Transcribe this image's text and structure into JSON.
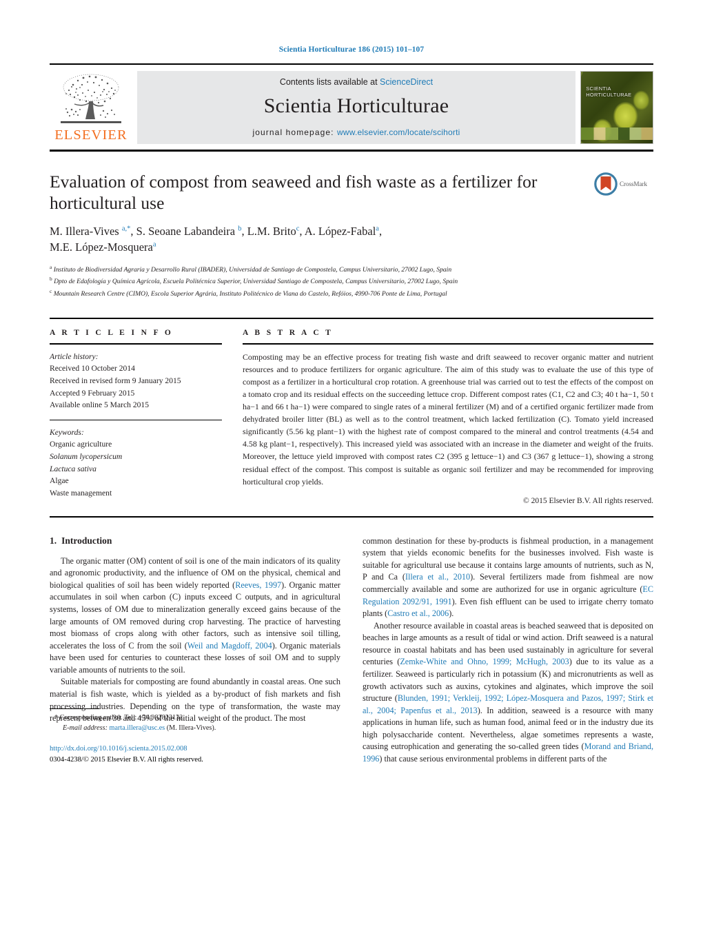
{
  "running_head": "Scientia Horticulturae 186 (2015) 101–107",
  "masthead": {
    "publisher_logo_text": "ELSEVIER",
    "contents_prefix": "Contents lists available at ",
    "contents_link": "ScienceDirect",
    "journal_name": "Scientia Horticulturae",
    "homepage_prefix": "journal homepage: ",
    "homepage_url": "www.elsevier.com/locate/scihorti",
    "cover_title": "SCIENTIA HORTICULTURAE"
  },
  "article": {
    "title": "Evaluation of compost from seaweed and fish waste as a fertilizer for horticultural use",
    "crossmark_label": "CrossMark",
    "authors_line_1": "M. Illera-Vives ",
    "authors_line_1_sup": "a,*",
    "authors_line_1_b": ", S. Seoane Labandeira ",
    "authors_line_1_sup_b": "b",
    "authors_line_1_c": ", L.M. Brito",
    "authors_line_1_sup_c": "c",
    "authors_line_1_d": ", A. López-Fabal",
    "authors_line_1_sup_d": "a",
    "authors_line_1_e": ",",
    "authors_line_2": "M.E. López-Mosquera",
    "authors_line_2_sup": "a",
    "affiliations": [
      {
        "mark": "a",
        "text": "Instituto de Biodiversidad Agraria y Desarrollo Rural (IBADER), Universidad de Santiago de Compostela, Campus Universitario, 27002 Lugo, Spain"
      },
      {
        "mark": "b",
        "text": "Dpto de Edafología y Química Agrícola, Escuela Politécnica Superior, Universidad Santiago de Compostela, Campus Universitario, 27002 Lugo, Spain"
      },
      {
        "mark": "c",
        "text": "Mountain Research Centre (CIMO), Escola Superior Agrária, Instituto Politécnico de Viana do Castelo, Refóios, 4990-706 Ponte de Lima, Portugal"
      }
    ]
  },
  "article_info": {
    "heading": "A R T I C L E    I N F O",
    "history_label": "Article history:",
    "history": [
      "Received 10 October 2014",
      "Received in revised form 9 January 2015",
      "Accepted 9 February 2015",
      "Available online 5 March 2015"
    ],
    "keywords_label": "Keywords:",
    "keywords": [
      {
        "text": "Organic agriculture",
        "italic": false
      },
      {
        "text": "Solanum lycopersicum",
        "italic": true
      },
      {
        "text": "Lactuca sativa",
        "italic": true
      },
      {
        "text": "Algae",
        "italic": false
      },
      {
        "text": "Waste management",
        "italic": false
      }
    ]
  },
  "abstract": {
    "heading": "A B S T R A C T",
    "text": "Composting may be an effective process for treating fish waste and drift seaweed to recover organic matter and nutrient resources and to produce fertilizers for organic agriculture. The aim of this study was to evaluate the use of this type of compost as a fertilizer in a horticultural crop rotation. A greenhouse trial was carried out to test the effects of the compost on a tomato crop and its residual effects on the succeeding lettuce crop. Different compost rates (C1, C2 and C3; 40 t ha−1, 50 t ha−1 and 66 t ha−1) were compared to single rates of a mineral fertilizer (M) and of a certified organic fertilizer made from dehydrated broiler litter (BL) as well as to the control treatment, which lacked fertilization (C). Tomato yield increased significantly (5.56 kg plant−1) with the highest rate of compost compared to the mineral and control treatments (4.54 and 4.58 kg plant−1, respectively). This increased yield was associated with an increase in the diameter and weight of the fruits. Moreover, the lettuce yield improved with compost rates C2 (395 g lettuce−1) and C3 (367 g lettuce−1), showing a strong residual effect of the compost. This compost is suitable as organic soil fertilizer and may be recommended for improving horticultural crop yields.",
    "copyright": "© 2015 Elsevier B.V. All rights reserved."
  },
  "body": {
    "section_number": "1.",
    "section_title": "Introduction",
    "left_paragraph_1_a": "The organic matter (OM) content of soil is one of the main indicators of its quality and agronomic productivity, and the influence of OM on the physical, chemical and biological qualities of soil has been widely reported (",
    "left_paragraph_1_ref1": "Reeves, 1997",
    "left_paragraph_1_b": "). Organic matter accumulates in soil when carbon (C) inputs exceed C outputs, and in agricultural systems, losses of OM due to mineralization generally exceed gains because of the large amounts of OM removed during crop harvesting. The practice of harvesting most biomass of crops along with other factors, such as intensive soil tilling, accelerates the loss of C from the soil (",
    "left_paragraph_1_ref2": "Weil and Magdoff, 2004",
    "left_paragraph_1_c": "). Organic materials have been used for centuries to counteract these losses of soil OM and to supply variable amounts of nutrients to the soil.",
    "left_paragraph_2": "Suitable materials for composting are found abundantly in coastal areas. One such material is fish waste, which is yielded as a by-product of fish markets and fish processing industries. Depending on the type of transformation, the waste may represent between 30 and 45% of the initial weight of the product. The most",
    "right_paragraph_1_a": "common destination for these by-products is fishmeal production, in a management system that yields economic benefits for the businesses involved. Fish waste is suitable for agricultural use because it contains large amounts of nutrients, such as N, P and Ca (",
    "right_paragraph_1_ref1": "Illera et al., 2010",
    "right_paragraph_1_b": "). Several fertilizers made from fishmeal are now commercially available and some are authorized for use in organic agriculture (",
    "right_paragraph_1_ref2": "EC Regulation 2092/91, 1991",
    "right_paragraph_1_c": "). Even fish effluent can be used to irrigate cherry tomato plants (",
    "right_paragraph_1_ref3": "Castro et al., 2006",
    "right_paragraph_1_d": ").",
    "right_paragraph_2_a": "Another resource available in coastal areas is beached seaweed that is deposited on beaches in large amounts as a result of tidal or wind action. Drift seaweed is a natural resource in coastal habitats and has been used sustainably in agriculture for several centuries (",
    "right_paragraph_2_ref1": "Zemke-White and Ohno, 1999; McHugh, 2003",
    "right_paragraph_2_b": ") due to its value as a fertilizer. Seaweed is particularly rich in potassium (K) and micronutrients as well as growth activators such as auxins, cytokines and alginates, which improve the soil structure (",
    "right_paragraph_2_ref2": "Blunden, 1991; Verkleij, 1992; López-Mosquera and Pazos, 1997; Stirk et al., 2004; Papenfus et al., 2013",
    "right_paragraph_2_c": "). In addition, seaweed is a resource with many applications in human life, such as human food, animal feed or in the industry due its high polysaccharide content. Nevertheless, algae sometimes represents a waste, causing eutrophication and generating the so-called green tides (",
    "right_paragraph_2_ref3": "Morand and Briand, 1996",
    "right_paragraph_2_d": ") that cause serious environmental problems in different parts of the"
  },
  "footer": {
    "corresponding_star": "*",
    "corresponding_text": "Corresponding author. Tel.: +34 982823132.",
    "email_label": "E-mail address:",
    "email": "marta.illera@usc.es",
    "email_suffix": "(M. Illera-Vives).",
    "doi": "http://dx.doi.org/10.1016/j.scienta.2015.02.008",
    "issn_line": "0304-4238/© 2015 Elsevier B.V. All rights reserved."
  },
  "colors": {
    "link_blue": "#1f7bb6",
    "elsevier_orange": "#f36f21",
    "band_gray": "#e6e7e8"
  }
}
